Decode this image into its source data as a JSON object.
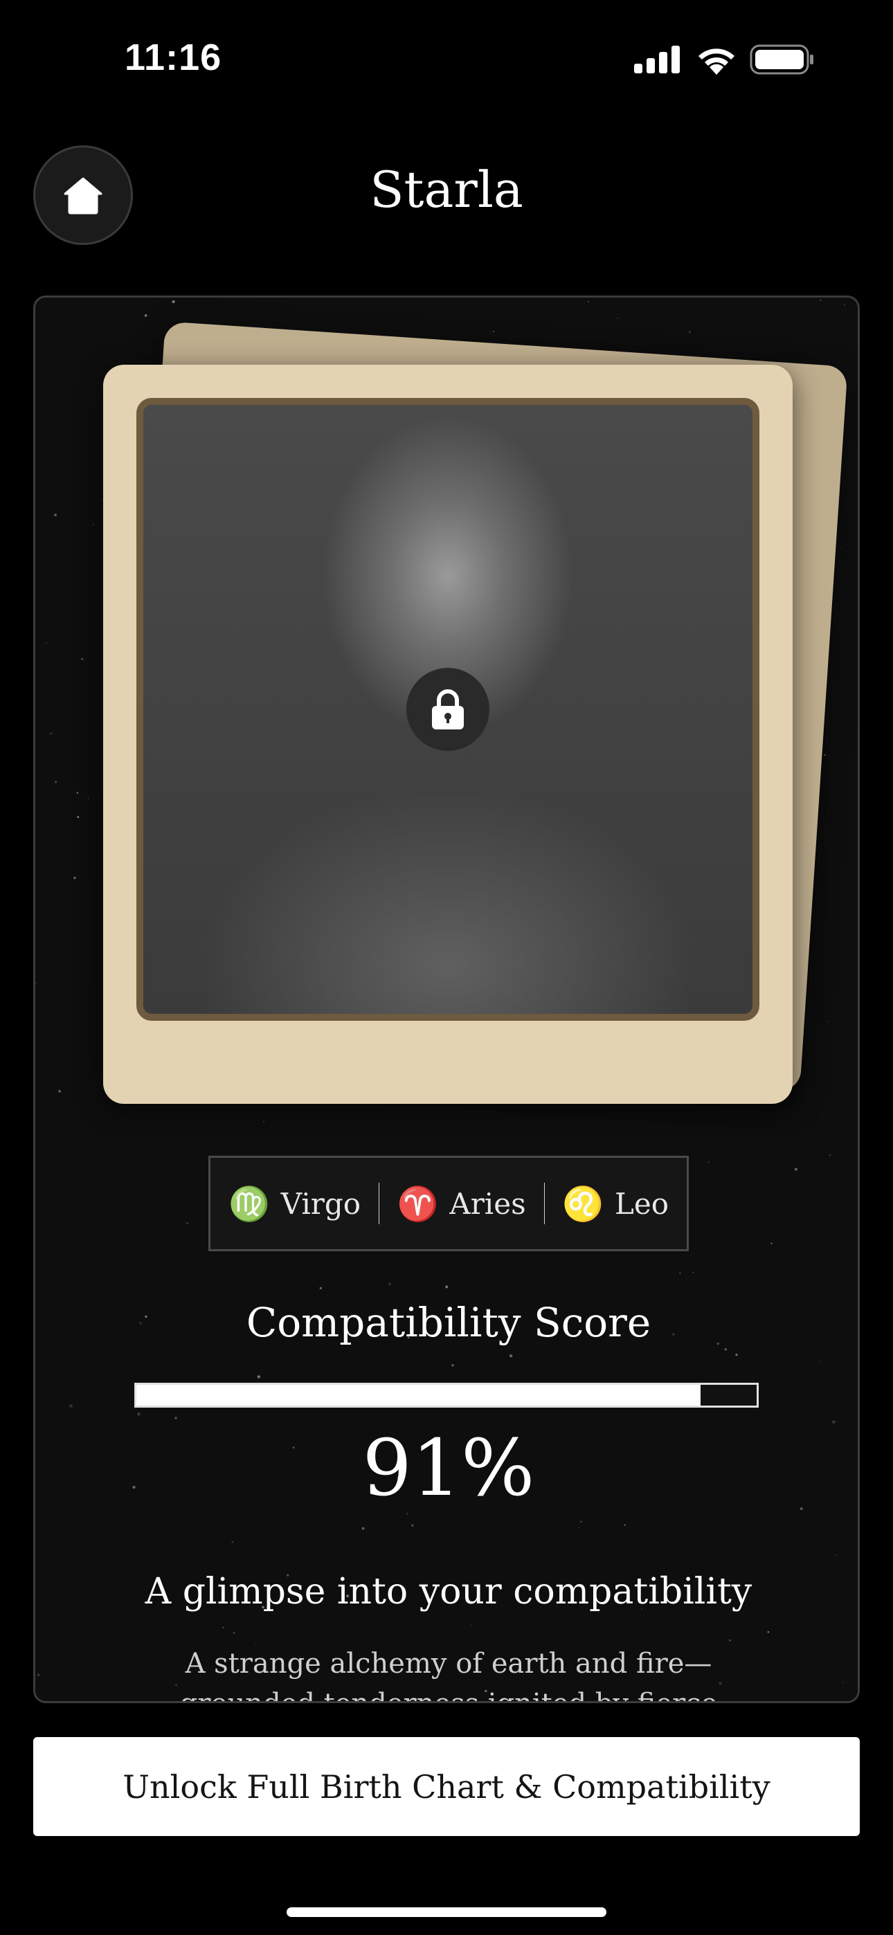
{
  "status_bar": {
    "time": "11:16"
  },
  "header": {
    "title": "Starla"
  },
  "card": {
    "signs": [
      {
        "glyph": "♍",
        "label": "Virgo"
      },
      {
        "glyph": "♈",
        "label": "Aries"
      },
      {
        "glyph": "♌",
        "label": "Leo"
      }
    ],
    "score_title": "Compatibility Score",
    "score_value": "91%",
    "score_fraction": 0.91,
    "glimpse_heading": "A glimpse into your compatibility",
    "glimpse_body": "A strange alchemy of earth and fire—grounded tenderness ignited by fierce curiosity, a love that"
  },
  "cta": {
    "label": "Unlock Full Birth Chart & Compatibility"
  },
  "icons": {
    "home": "home-icon",
    "lock": "lock-icon",
    "signal": "cellular-signal-icon",
    "wifi": "wifi-icon",
    "battery": "battery-icon"
  },
  "colors": {
    "frame": "#e3d3b3",
    "frame_back": "#bfae8e",
    "frame_border": "#6e5a3f",
    "background": "#000000"
  }
}
